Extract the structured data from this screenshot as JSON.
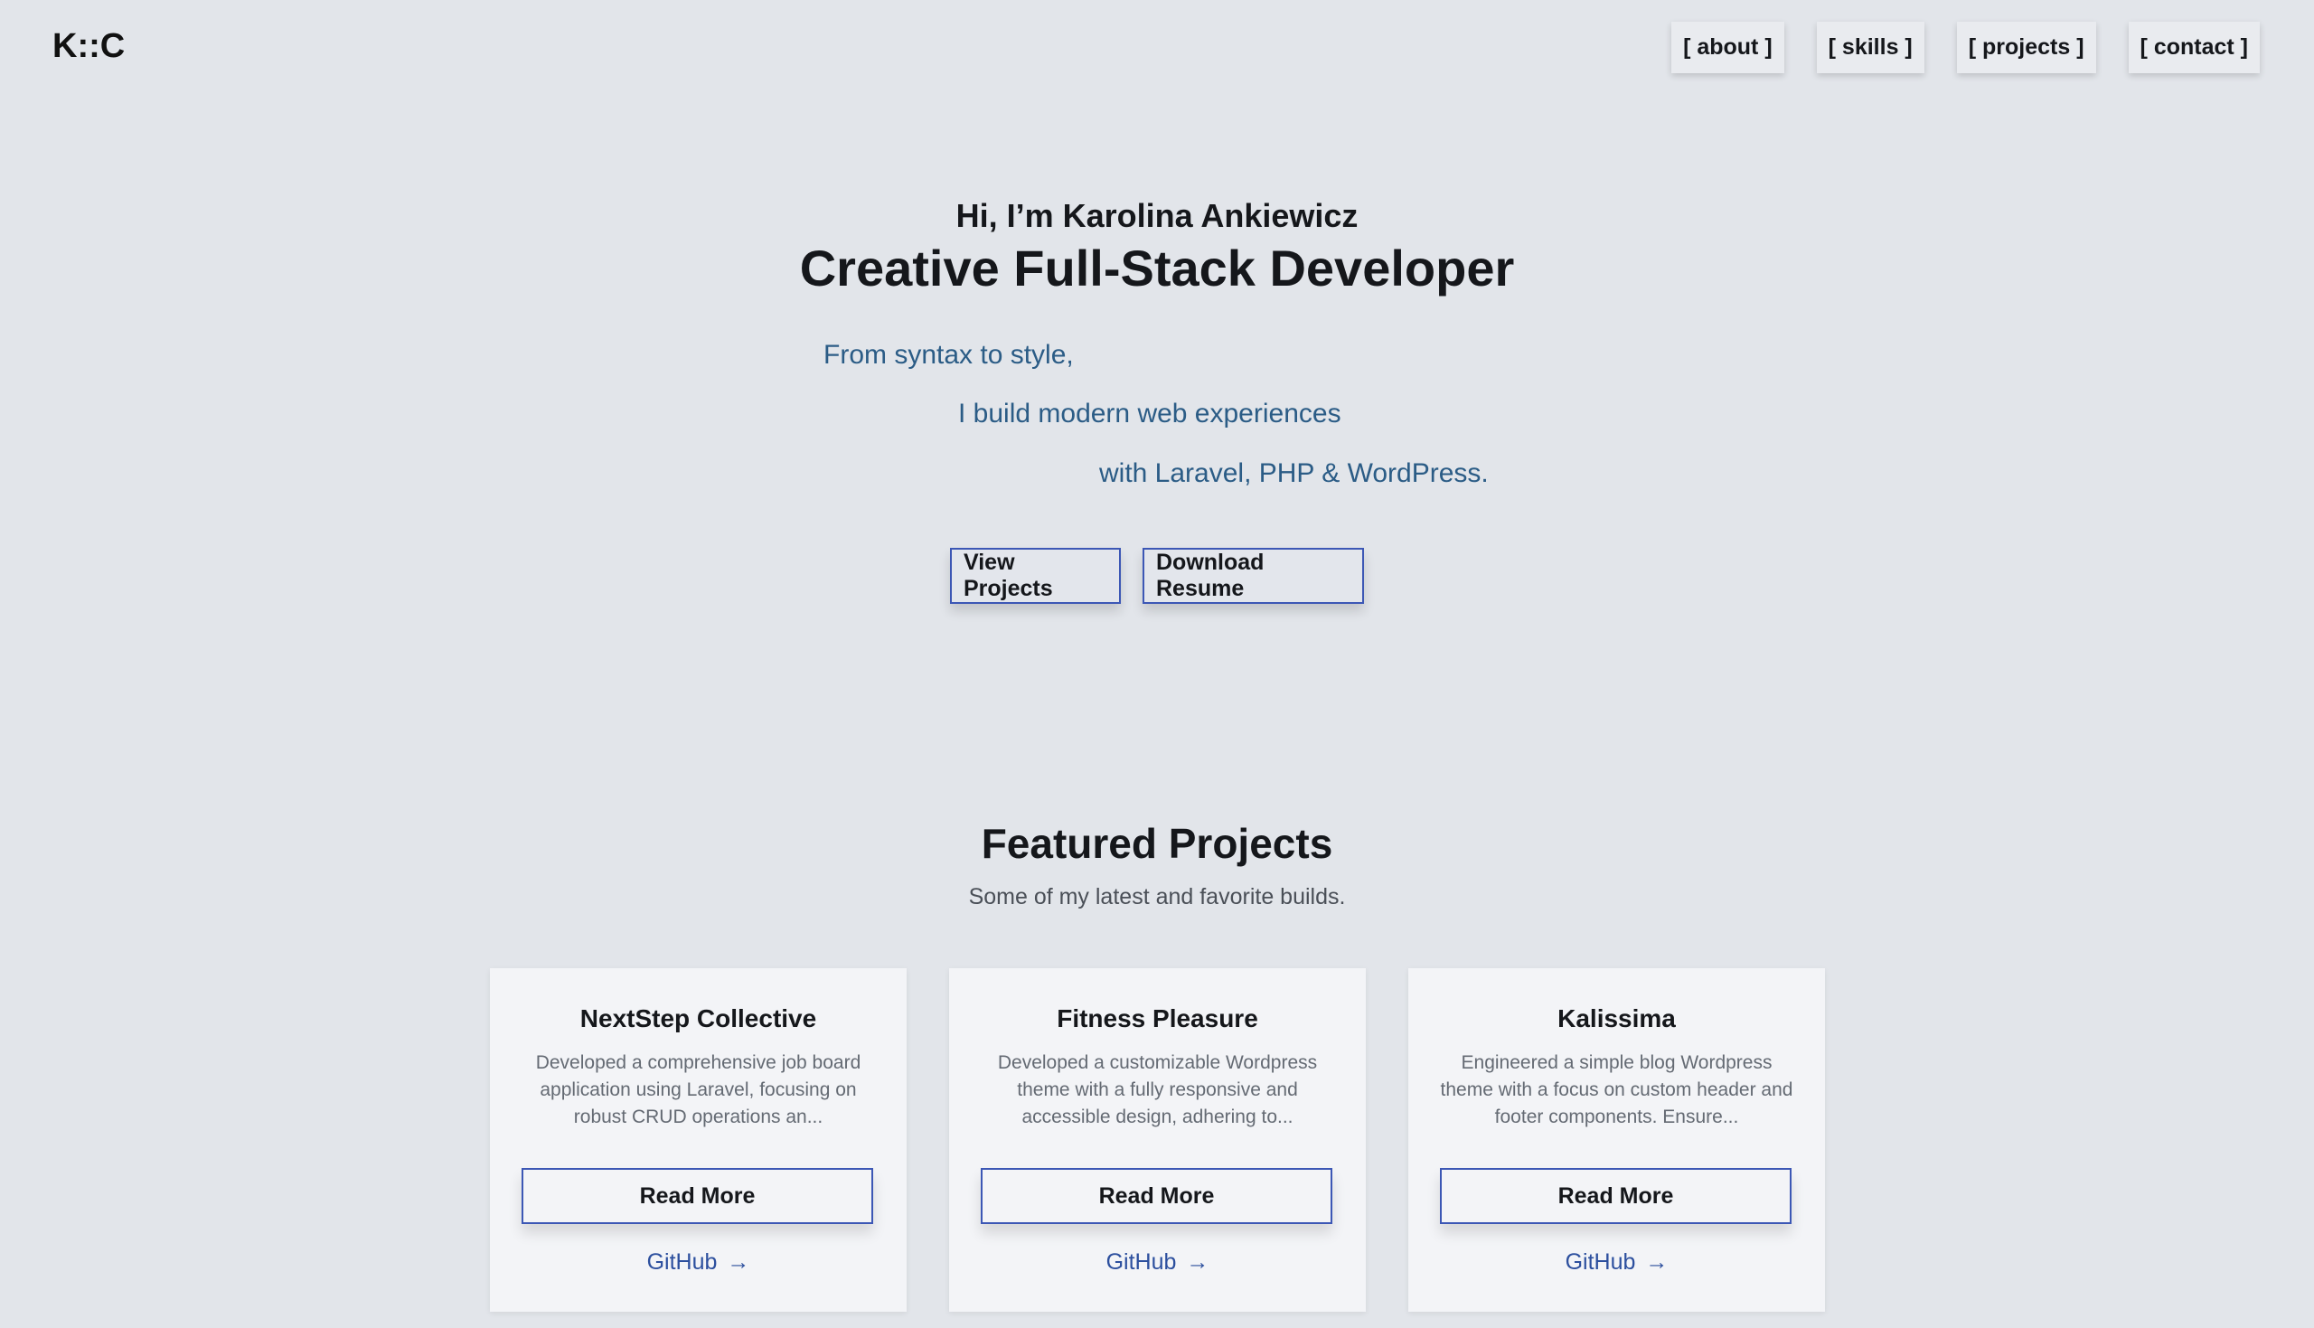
{
  "header": {
    "logo": "K::C",
    "nav": [
      {
        "label": "[ about ]"
      },
      {
        "label": "[ skills ]"
      },
      {
        "label": "[ projects ]"
      },
      {
        "label": "[ contact ]"
      }
    ]
  },
  "hero": {
    "greeting": "Hi, I’m Karolina Ankiewicz",
    "title": "Creative Full-Stack Developer",
    "tagline": [
      "From syntax to style,",
      "I build modern web experiences",
      "with Laravel, PHP & WordPress."
    ],
    "buttons": {
      "view_projects": "View Projects",
      "download_resume": "Download Resume"
    }
  },
  "featured": {
    "title": "Featured Projects",
    "subtitle": "Some of my latest and favorite builds.",
    "projects": [
      {
        "title": "NextStep Collective",
        "description": "Developed a comprehensive job board application using Laravel, focusing on robust CRUD operations an...",
        "read_more": "Read More",
        "github": "GitHub",
        "arrow": "→"
      },
      {
        "title": "Fitness Pleasure",
        "description": "Developed a customizable Wordpress theme with a fully responsive and accessible design, adhering to...",
        "read_more": "Read More",
        "github": "GitHub",
        "arrow": "→"
      },
      {
        "title": "Kalissima",
        "description": "Engineered a simple blog Wordpress theme with a focus on custom header and footer components. Ensure...",
        "read_more": "Read More",
        "github": "GitHub",
        "arrow": "→"
      }
    ]
  },
  "colors": {
    "background": "#e2e5ea",
    "accent_border": "#3c57b5",
    "tagline": "#2b5c86",
    "link": "#2c4f9e"
  }
}
